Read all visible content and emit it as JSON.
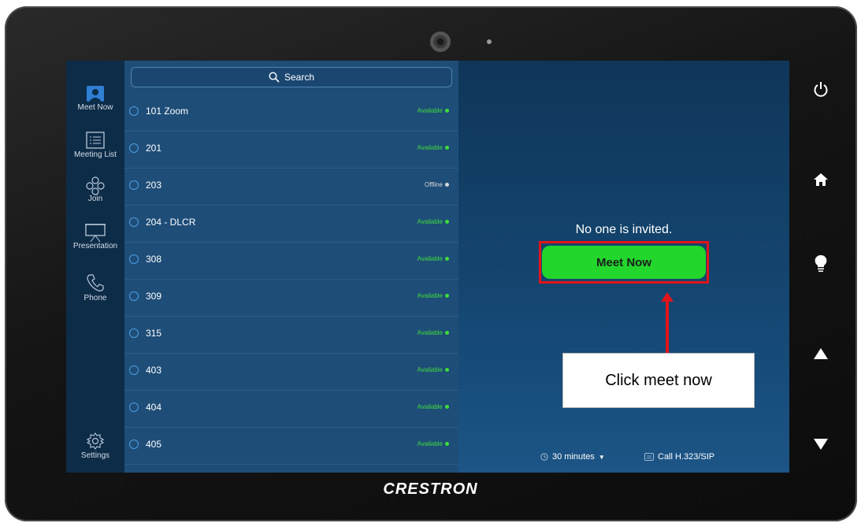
{
  "brand": "CRESTRON",
  "nav": {
    "items": [
      {
        "label": "Meet Now"
      },
      {
        "label": "Meeting List"
      },
      {
        "label": "Join"
      },
      {
        "label": "Presentation"
      },
      {
        "label": "Phone"
      }
    ],
    "settings_label": "Settings"
  },
  "search": {
    "placeholder": "Search"
  },
  "rooms": [
    {
      "name": "101 Zoom",
      "status": "Available"
    },
    {
      "name": "201",
      "status": "Available"
    },
    {
      "name": "203",
      "status": "Offline"
    },
    {
      "name": "204 - DLCR",
      "status": "Available"
    },
    {
      "name": "308",
      "status": "Available"
    },
    {
      "name": "309",
      "status": "Available"
    },
    {
      "name": "315",
      "status": "Available"
    },
    {
      "name": "403",
      "status": "Available"
    },
    {
      "name": "404",
      "status": "Available"
    },
    {
      "name": "405",
      "status": "Available"
    }
  ],
  "main": {
    "no_invite_text": "No one is invited.",
    "meet_now_label": "Meet Now",
    "callout_text": "Click meet now",
    "duration_label": "30 minutes",
    "call_label": "Call H.323/SIP"
  },
  "colors": {
    "available": "#3fdc3a",
    "offline": "#d8d8d8",
    "meet_button": "#22d62c",
    "highlight": "#e2141b"
  },
  "side_buttons": [
    "power-icon",
    "home-icon",
    "light-bulb-icon",
    "up-arrow-icon",
    "down-arrow-icon"
  ]
}
